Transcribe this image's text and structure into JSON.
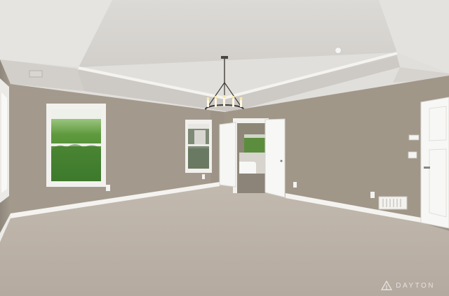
{
  "photo": {
    "subject": "empty-bedroom-interior",
    "watermark": "DAYTON",
    "colors": {
      "wall": "#a49b8e",
      "ceiling": "#e0dedb",
      "carpet": "#bcb2a8",
      "trim": "#f7f7f5",
      "foliage": "#4f8a35"
    }
  }
}
